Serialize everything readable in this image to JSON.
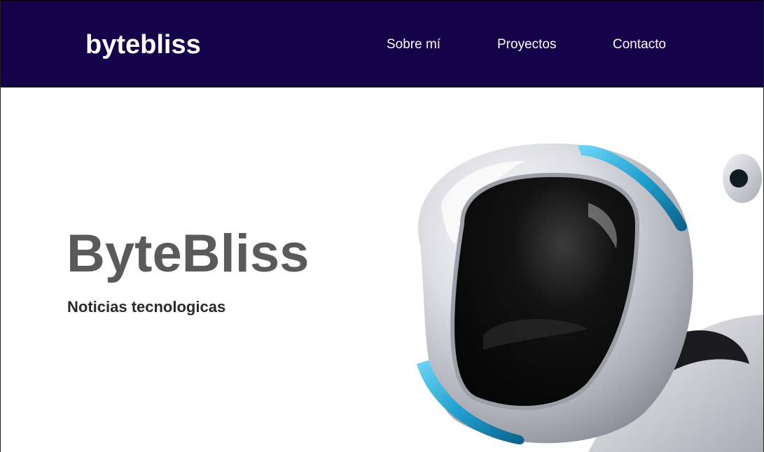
{
  "header": {
    "brand": "bytebliss",
    "nav": [
      "Sobre mí",
      "Proyectos",
      "Contacto"
    ]
  },
  "hero": {
    "title": "ByteBliss",
    "subtitle": "Noticias tecnologicas",
    "image_icon": "robot-head-illustration"
  },
  "colors": {
    "header_bg": "#15004a",
    "title": "#5a5a5a",
    "subtitle": "#2a2a2a",
    "accent": "#1fa8d8"
  }
}
